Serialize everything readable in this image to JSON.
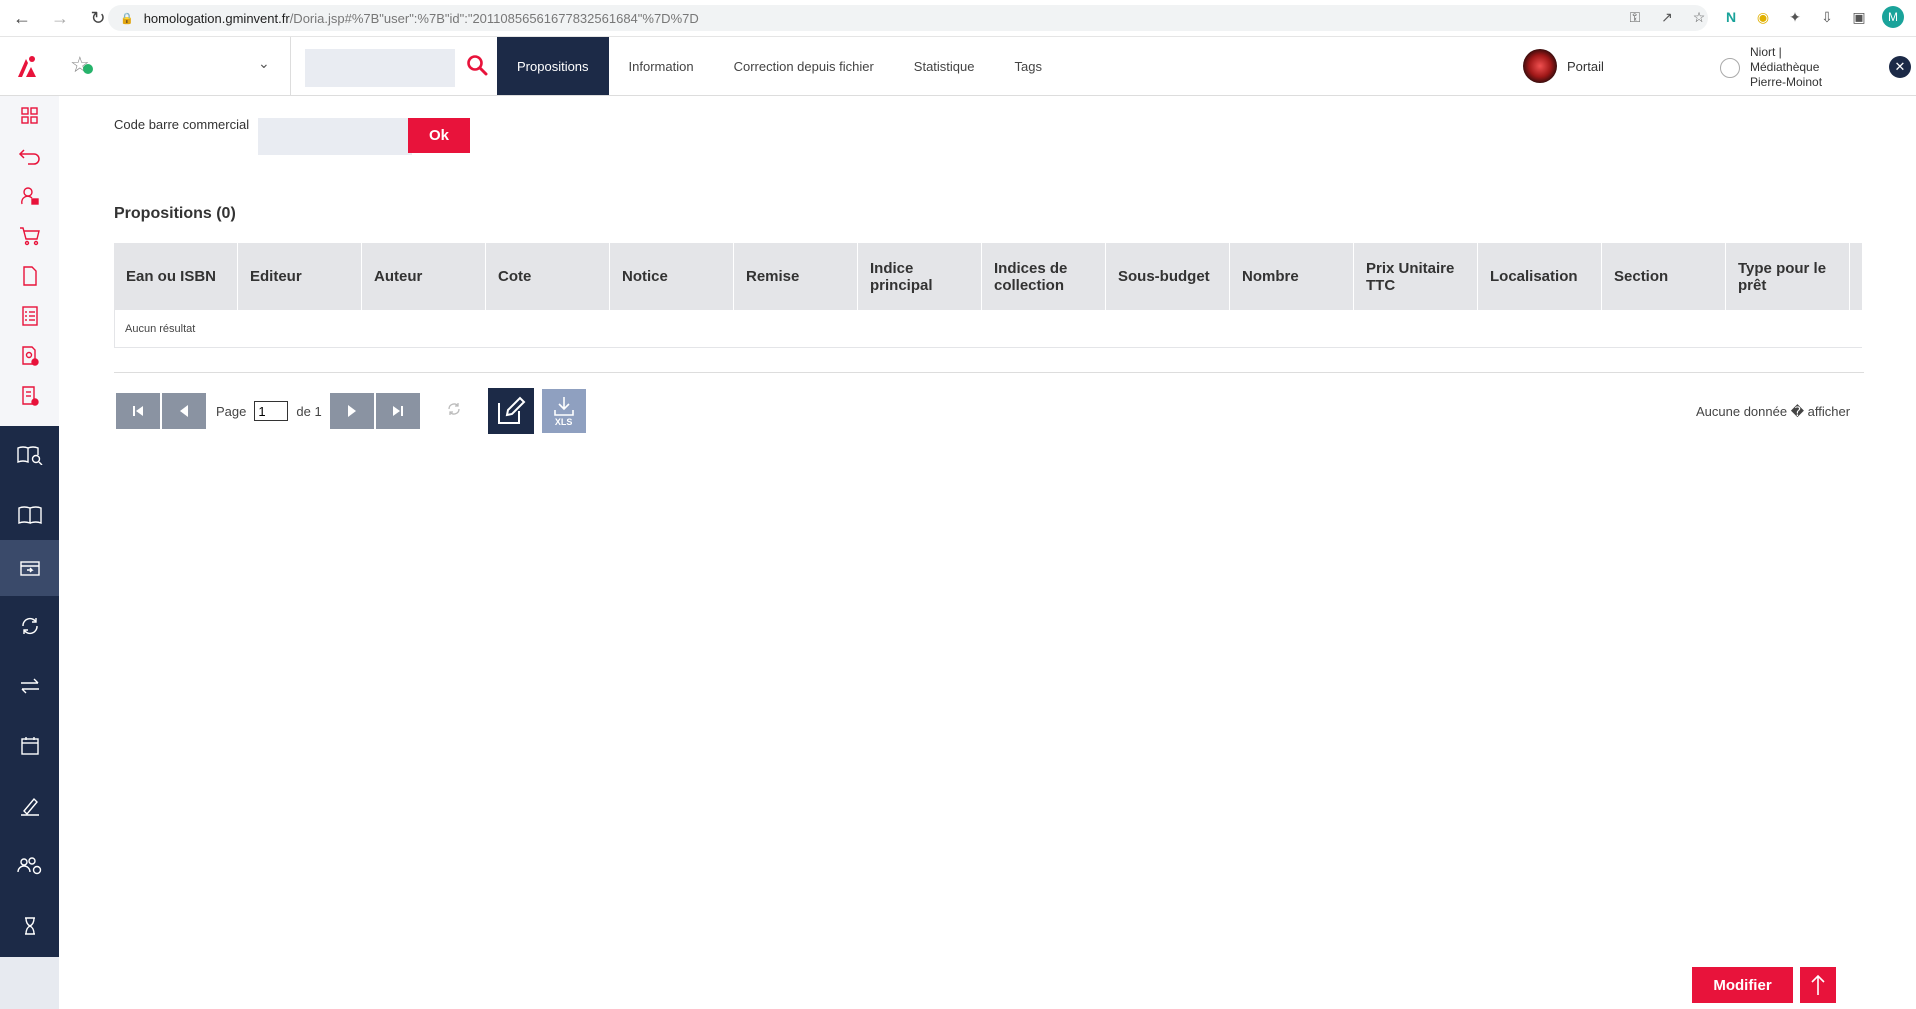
{
  "browser": {
    "url_host": "homologation.gminvent.fr",
    "url_path": "/Doria.jsp#%7B\"user\":%7B\"id\":\"20110856561677832561684\"%7D%7D",
    "profile_initial": "M"
  },
  "header": {
    "search_placeholder": "",
    "tabs": [
      {
        "label": "Propositions",
        "active": true
      },
      {
        "label": "Information",
        "active": false
      },
      {
        "label": "Correction depuis fichier",
        "active": false
      },
      {
        "label": "Statistique",
        "active": false
      },
      {
        "label": "Tags",
        "active": false
      }
    ],
    "portail_label": "Portail",
    "library_line1": "Niort |",
    "library_line2": "Médiathèque",
    "library_line3": "Pierre-Moinot"
  },
  "colors": {
    "accent": "#e8133b",
    "navy": "#1c2a47"
  },
  "sidebar": {
    "items": [
      {
        "icon": "dashboard-icon"
      },
      {
        "icon": "return-icon"
      },
      {
        "icon": "user-lock-icon"
      },
      {
        "icon": "cart-icon"
      },
      {
        "icon": "document-icon"
      },
      {
        "icon": "checklist-icon"
      },
      {
        "icon": "document-user-icon"
      },
      {
        "icon": "document-edit-icon"
      },
      {
        "icon": "book-search-icon"
      },
      {
        "icon": "book-icon"
      },
      {
        "icon": "inbox-icon"
      },
      {
        "icon": "sync-icon"
      },
      {
        "icon": "transfer-icon"
      },
      {
        "icon": "calendar-icon"
      },
      {
        "icon": "signature-icon"
      },
      {
        "icon": "users-settings-icon"
      },
      {
        "icon": "hourglass-icon"
      }
    ]
  },
  "barcode": {
    "label": "Code barre commercial",
    "value": "",
    "button": "Ok"
  },
  "section": {
    "title": "Propositions (0)"
  },
  "table": {
    "columns": [
      "Ean ou ISBN",
      "Editeur",
      "Auteur",
      "Cote",
      "Notice",
      "Remise",
      "Indice principal",
      "Indices de collection",
      "Sous-budget",
      "Nombre",
      "Prix Unitaire TTC",
      "Localisation",
      "Section",
      "Type pour le prêt"
    ],
    "empty_message": "Aucun résultat"
  },
  "pager": {
    "page_label": "Page",
    "page_value": "1",
    "of_label": "de 1",
    "xls_label": "XLS"
  },
  "no_data_text": "Aucune donnée � afficher",
  "footer": {
    "modify_label": "Modifier"
  }
}
